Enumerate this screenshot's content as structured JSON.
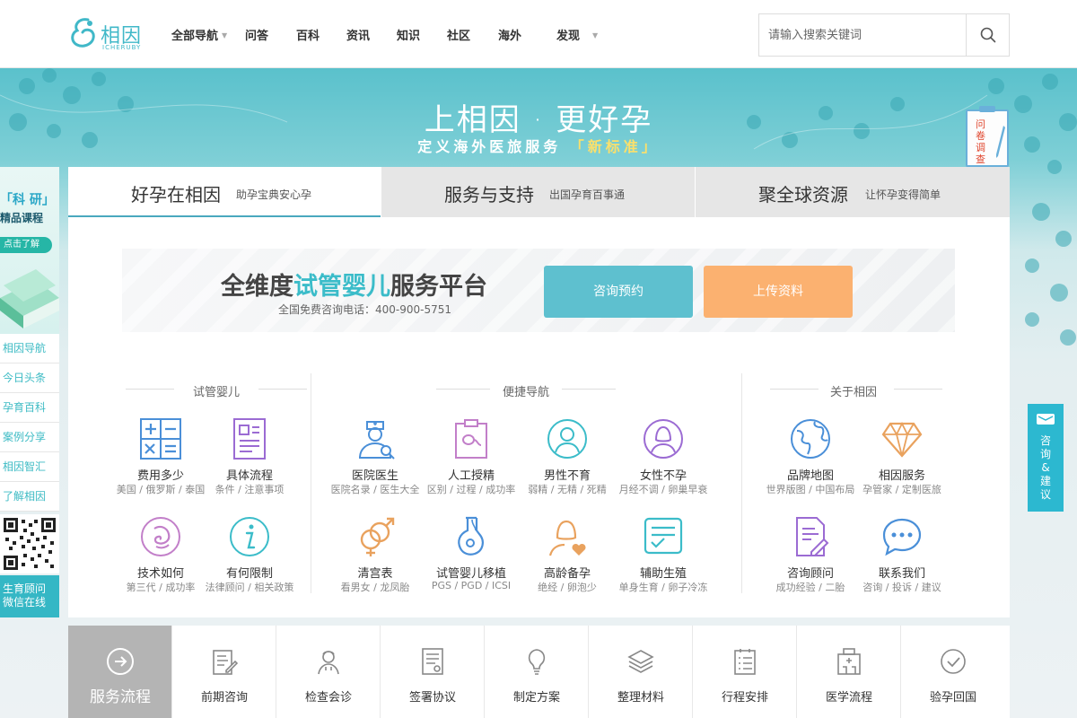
{
  "brand": {
    "name": "相因",
    "sub": "ICHERUBY",
    "color": "#40b8c8"
  },
  "nav": {
    "items": [
      "全部导航",
      "问答",
      "百科",
      "资讯",
      "知识",
      "社区",
      "海外",
      "发现"
    ]
  },
  "search": {
    "placeholder": "请输入搜索关键词",
    "icon": "search-icon"
  },
  "banner": {
    "title": "上相因 · 更好孕",
    "sub_prefix": "定义海外医旅服务",
    "sub_highlight": "「新标准」"
  },
  "survey": {
    "label": "问卷调查"
  },
  "feedback": {
    "label": "咨询&建议"
  },
  "left_sidebar": {
    "promo_line1": "「科 研」",
    "promo_line2": "精品课程",
    "promo_btn": "点击了解",
    "items": [
      "相因导航",
      "今日头条",
      "孕育百科",
      "案例分享",
      "相因智汇",
      "了解相因"
    ],
    "wechat_line1": "生育顾问",
    "wechat_line2": "微信在线"
  },
  "tabs": [
    {
      "title": "好孕在相因",
      "sub": "助孕宝典安心孕"
    },
    {
      "title": "服务与支持",
      "sub": "出国孕育百事通"
    },
    {
      "title": "聚全球资源",
      "sub": "让怀孕变得简单"
    }
  ],
  "promo_panel": {
    "title_prefix": "全维度",
    "title_highlight": "试管婴儿",
    "title_suffix": "服务平台",
    "phone": "全国免费咨询电话：400-900-5751",
    "consult_btn": "咨询预约",
    "upload_btn": "上传资料"
  },
  "sections": {
    "ivf": {
      "title": "试管婴儿",
      "items": [
        {
          "label": "费用多少",
          "sub": "美国 / 俄罗斯 / 泰国",
          "icon": "calculator-icon"
        },
        {
          "label": "具体流程",
          "sub": "条件 / 注意事项",
          "icon": "document-icon"
        },
        {
          "label": "技术如何",
          "sub": "第三代 / 成功率",
          "icon": "embryo-icon"
        },
        {
          "label": "有何限制",
          "sub": "法律顾问 / 相关政策",
          "icon": "info-icon"
        }
      ]
    },
    "quick": {
      "title": "便捷导航",
      "items": [
        {
          "label": "医院医生",
          "sub": "医院名录 / 医生大全",
          "icon": "doctor-icon"
        },
        {
          "label": "人工授精",
          "sub": "区别 / 过程 / 成功率",
          "icon": "sperm-icon"
        },
        {
          "label": "男性不育",
          "sub": "弱精 / 无精 / 死精",
          "icon": "male-icon"
        },
        {
          "label": "女性不孕",
          "sub": "月经不调 / 卵巢早衰",
          "icon": "female-icon"
        },
        {
          "label": "清宫表",
          "sub": "看男女 / 龙凤胎",
          "icon": "gender-icon"
        },
        {
          "label": "试管婴儿移植",
          "sub": "PGS / PGD / ICSI",
          "icon": "flask-icon"
        },
        {
          "label": "高龄备孕",
          "sub": "绝经 / 卵泡少",
          "icon": "woman-heart-icon"
        },
        {
          "label": "辅助生殖",
          "sub": "单身生育 / 卵子冷冻",
          "icon": "checklist-icon"
        }
      ]
    },
    "about": {
      "title": "关于相因",
      "items": [
        {
          "label": "品牌地图",
          "sub": "世界版图 / 中国布局",
          "icon": "globe-icon"
        },
        {
          "label": "相因服务",
          "sub": "孕管家 / 定制医旅",
          "icon": "diamond-icon"
        },
        {
          "label": "咨询顾问",
          "sub": "成功经验 / 二胎",
          "icon": "edit-doc-icon"
        },
        {
          "label": "联系我们",
          "sub": "咨询 / 投诉 / 建议",
          "icon": "chat-icon"
        }
      ]
    }
  },
  "bottom_steps": [
    {
      "label": "服务流程",
      "icon": "arrow-right-circle-icon"
    },
    {
      "label": "前期咨询",
      "icon": "note-edit-icon"
    },
    {
      "label": "检查会诊",
      "icon": "doctor-avatar-icon"
    },
    {
      "label": "签署协议",
      "icon": "contract-icon"
    },
    {
      "label": "制定方案",
      "icon": "lightbulb-icon"
    },
    {
      "label": "整理材料",
      "icon": "layers-icon"
    },
    {
      "label": "行程安排",
      "icon": "schedule-icon"
    },
    {
      "label": "医学流程",
      "icon": "hospital-icon"
    },
    {
      "label": "验孕回国",
      "icon": "check-circle-icon"
    }
  ],
  "colors": {
    "teal": "#3bbcc9",
    "orange": "#fbb170",
    "accent_blue": "#4aa8be",
    "purple": "#9b6bd3",
    "pink": "#c27fc9"
  }
}
